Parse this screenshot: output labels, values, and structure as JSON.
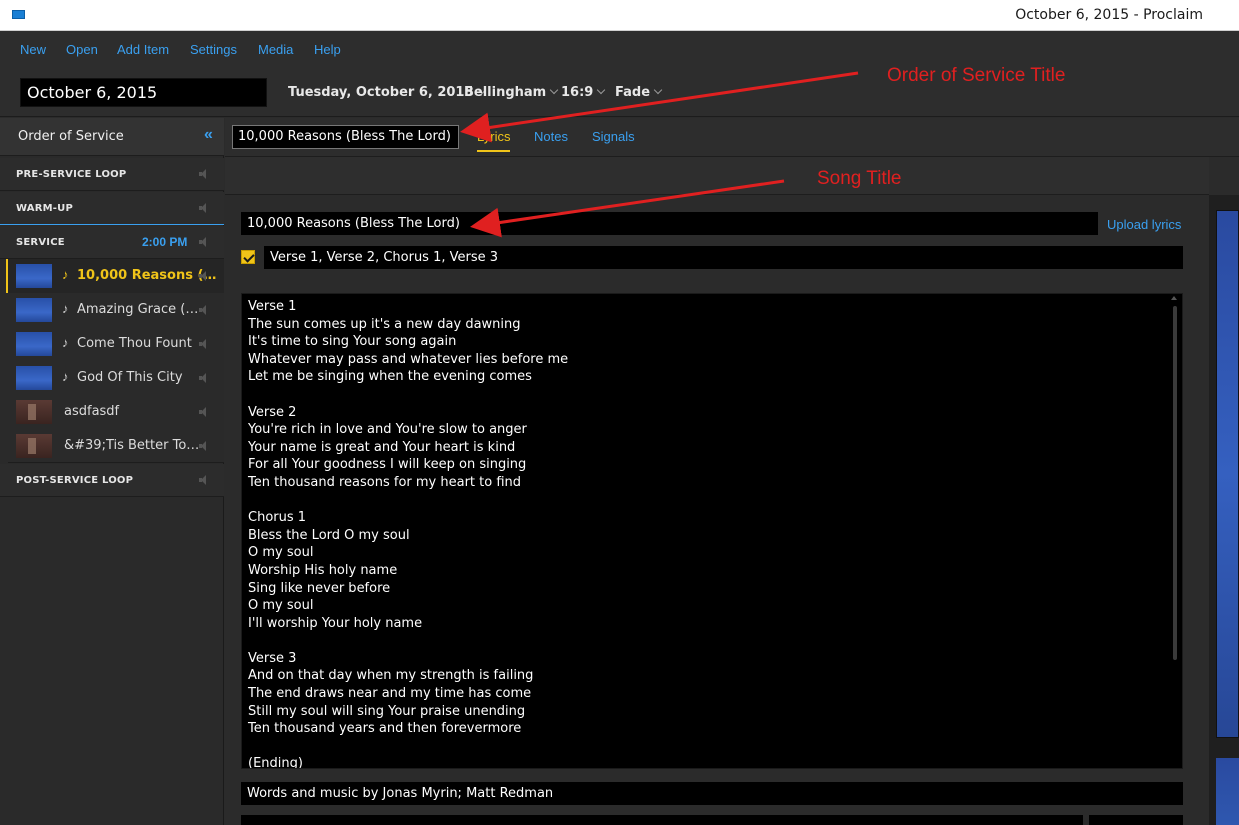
{
  "window": {
    "title": "October 6, 2015 - Proclaim"
  },
  "menu": [
    "New",
    "Open",
    "Add Item",
    "Settings",
    "Media",
    "Help"
  ],
  "service_bar": {
    "title_value": "October 6, 2015",
    "date": "Tuesday, October 6, 2015",
    "location": "Bellingham",
    "aspect": "16:9",
    "transition": "Fade"
  },
  "sidebar": {
    "header": "Order of Service",
    "collapse_glyph": "«",
    "sections": {
      "pre": "PRE-SERVICE LOOP",
      "warm": "WARM-UP",
      "service": "SERVICE",
      "service_time": "2:00 PM",
      "post": "POST-SERVICE LOOP"
    },
    "items": [
      {
        "name": "10,000 Reasons (…",
        "note": "♪",
        "thumb": "blue"
      },
      {
        "name": "Amazing Grace (…",
        "note": "♪",
        "thumb": "blue"
      },
      {
        "name": "Come Thou Fount",
        "note": "♪",
        "thumb": "blue"
      },
      {
        "name": "God Of This City",
        "note": "♪",
        "thumb": "blue"
      },
      {
        "name": "asdfasdf",
        "note": "",
        "thumb": "dark"
      },
      {
        "name": "&#39;Tis Better To…",
        "note": "",
        "thumb": "dark"
      }
    ]
  },
  "content": {
    "song_input_value": "10,000 Reasons (Bless The Lord)",
    "tabs": [
      "Lyrics",
      "Notes",
      "Signals"
    ],
    "song_title_value": "10,000 Reasons (Bless The Lord)",
    "upload_label": "Upload lyrics",
    "order_value": "Verse 1, Verse 2, Chorus 1, Verse 3",
    "lyrics": "Verse 1\nThe sun comes up it's a new day dawning\nIt's time to sing Your song again\nWhatever may pass and whatever lies before me\nLet me be singing when the evening comes\n\nVerse 2\nYou're rich in love and You're slow to anger\nYour name is great and Your heart is kind\nFor all Your goodness I will keep on singing\nTen thousand reasons for my heart to find\n\nChorus 1\nBless the Lord O my soul\nO my soul\nWorship His holy name\nSing like never before\nO my soul\nI'll worship Your holy name\n\nVerse 3\nAnd on that day when my strength is failing\nThe end draws near and my time has come\nStill my soul will sing Your praise unending\nTen thousand years and then forevermore\n\n(Ending)",
    "credits": "Words and music by Jonas Myrin; Matt Redman"
  },
  "annotations": {
    "order_title": "Order of Service Title",
    "song_title": "Song Title",
    "color": "#e02020"
  },
  "colors": {
    "accent": "#f0c419",
    "link": "#3aa0f0"
  }
}
